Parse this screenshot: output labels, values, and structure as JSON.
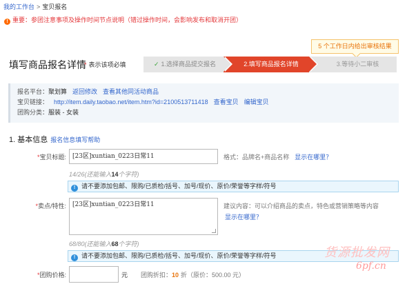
{
  "breadcrumb": {
    "home": "我的工作台",
    "sep": ">",
    "current": "宝贝报名"
  },
  "notice": {
    "text": "重要：参团注意事项及操作时间节点说明（错过操作时间，会影响发布和取消开团）"
  },
  "tip": {
    "text": "5 个工作日内给出审核结果"
  },
  "header": {
    "title": "填写商品报名详情",
    "required_star": "*",
    "required_note": "表示该项必填"
  },
  "steps": [
    {
      "label": "1.选择商品提交报名"
    },
    {
      "label": "2.填写商品报名详情"
    },
    {
      "label": "3.等待小二审核"
    }
  ],
  "info": {
    "platform_label": "报名平台：",
    "platform_value": "聚划算",
    "back_link": "返回修改",
    "other_link": "查看其他同活动商品",
    "link_label": "宝贝链接：",
    "link_value": "http://item.daily.taobao.net/item.htm?id=2100513711418",
    "view_link": "查看宝贝",
    "edit_link": "编辑宝贝",
    "category_label": "团购分类：",
    "category_value": "服装 - 女装"
  },
  "section": {
    "title": "1. 基本信息",
    "help_link": "报名信息填写帮助"
  },
  "form": {
    "title_label": "宝贝标题:",
    "title_value": "[23区]xuntian_0223日常11",
    "title_format": "格式：品牌名+商品名称",
    "title_where": "显示在哪里？",
    "title_count": "14/26",
    "title_remaining_pre": "(还能输入",
    "title_remaining_num": "14",
    "title_remaining_post": "个字符)",
    "title_warning": "请不要添加包邮、限购/已质检/括号、加号/现价、原价/荣誉等字样/符号",
    "selling_label": "卖点/特性:",
    "selling_value": "[23区]xuntian_0223日常11",
    "selling_suggest": "建议内容：可以介绍商品的卖点，特色或营销策略等内容",
    "selling_where": "显示在哪里？",
    "selling_count": "68/80",
    "selling_remaining_pre": "(还能输入",
    "selling_remaining_num": "68",
    "selling_remaining_post": "个字符)",
    "selling_warning": "请不要添加包邮、限购/已质检/括号、加号/现价、原价/荣誉等字样/符号",
    "price_label": "团购价格:",
    "price_unit": "元",
    "discount_label": "团购折扣：",
    "discount_value": "10",
    "discount_unit": "折（原价：500.00 元）"
  },
  "watermark": {
    "line1": "货源批发网",
    "line2": "6pf.cn"
  },
  "colors": {
    "accent_red": "#e1452a",
    "link_blue": "#3366cc",
    "warn_red": "#e4393c",
    "tip_orange": "#e8740c",
    "info_blue": "#2f8fdb"
  }
}
